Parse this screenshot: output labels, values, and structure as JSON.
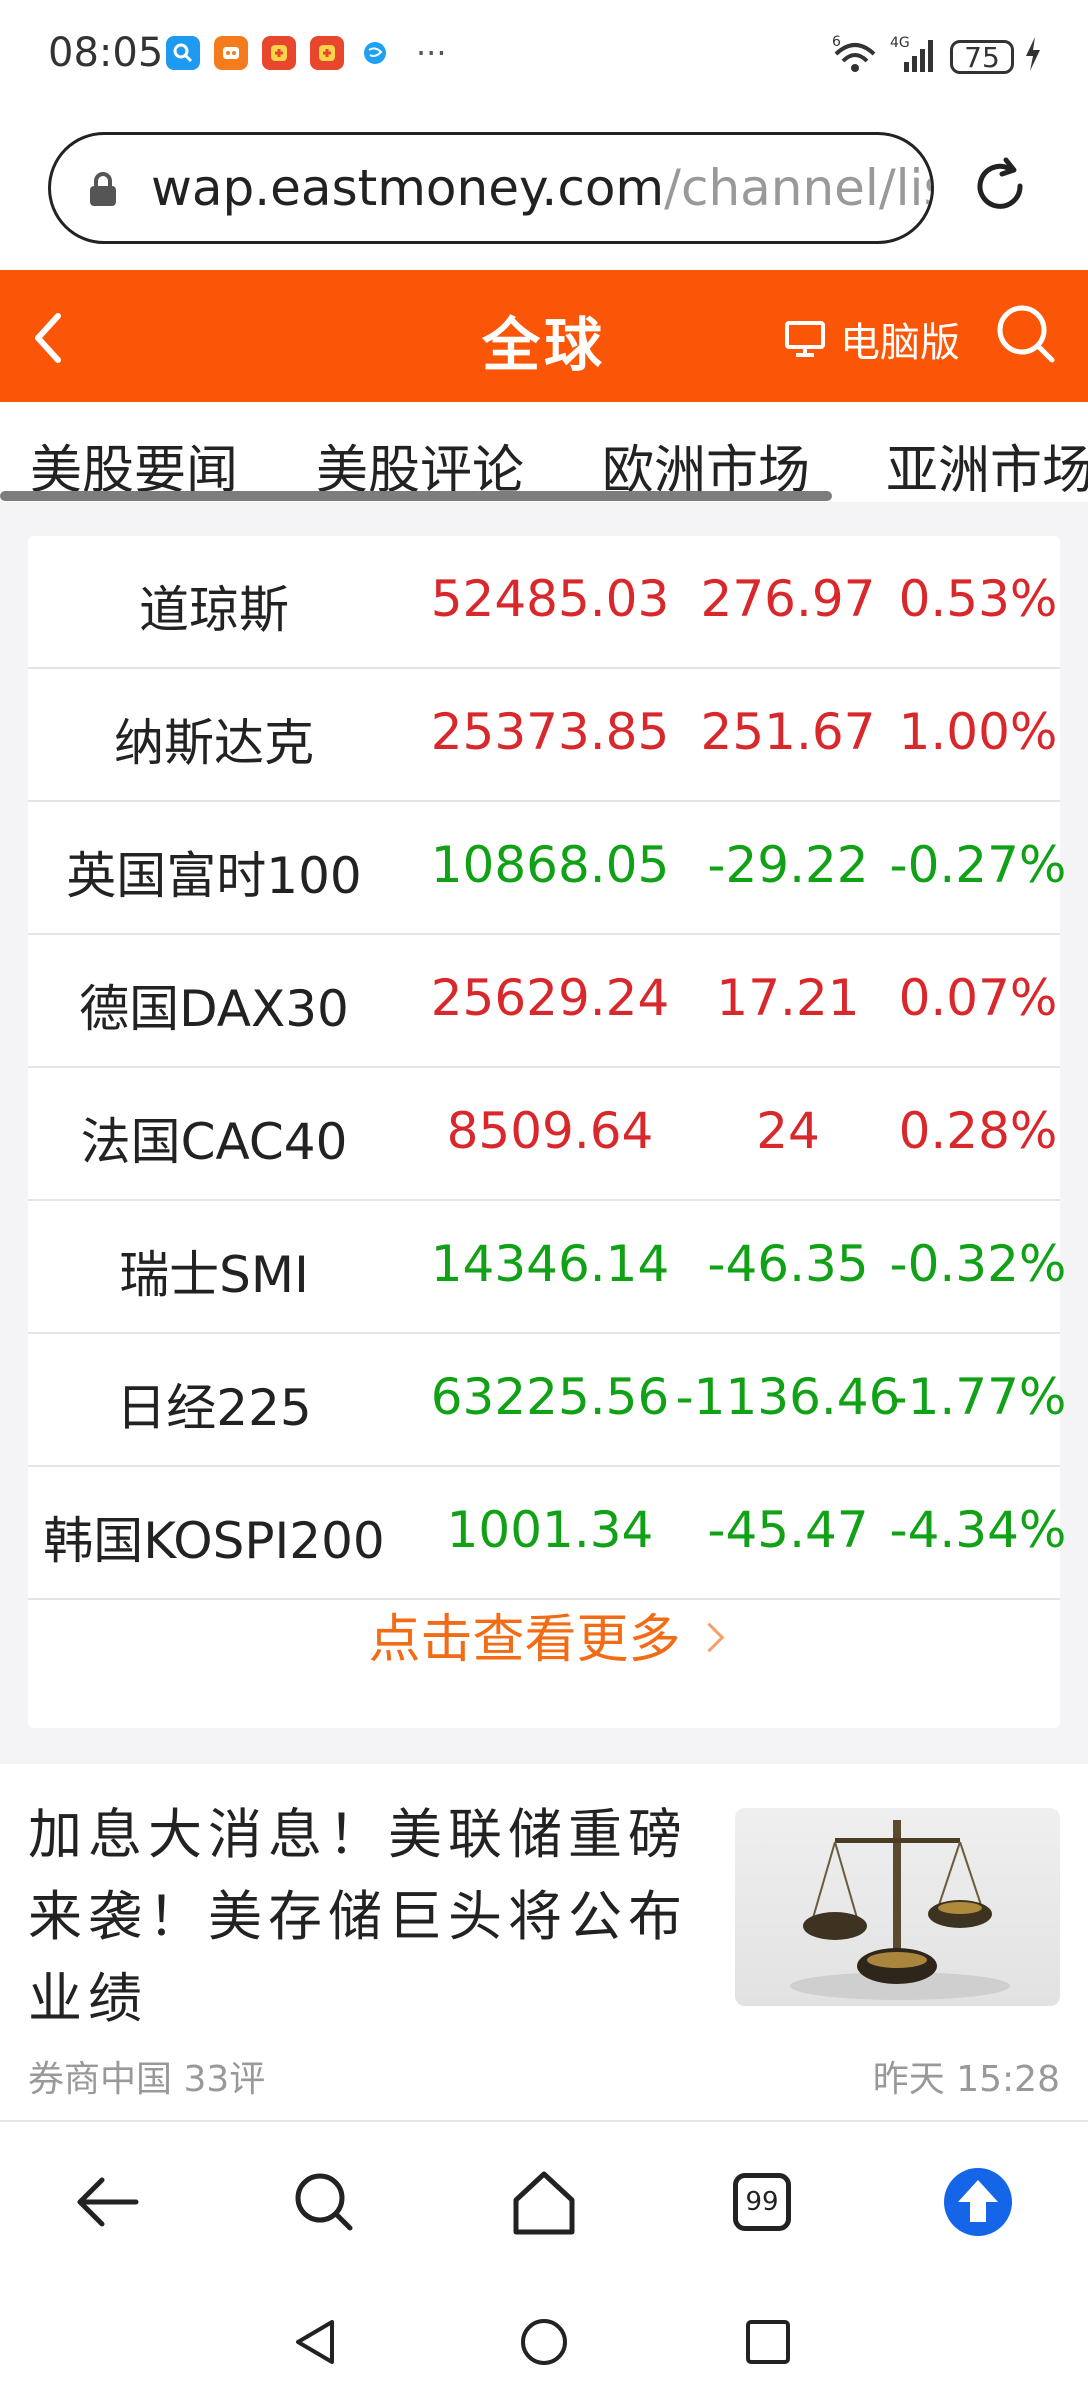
{
  "status_bar": {
    "time": "08:05",
    "more": "···",
    "network_label_1": "6",
    "network_label_2": "4G",
    "battery": "75",
    "app_icons": [
      {
        "name": "app-icon-blue-search",
        "color": "#1e9af0"
      },
      {
        "name": "app-icon-orange",
        "color": "#f47c1d"
      },
      {
        "name": "app-icon-taobao-1",
        "color": "#e8462d"
      },
      {
        "name": "app-icon-taobao-2",
        "color": "#e8462d"
      },
      {
        "name": "app-icon-globe",
        "color": "#1ea1f2"
      }
    ]
  },
  "browser": {
    "url_domain": "wap.eastmoney.com",
    "url_rest": "/channel/lis"
  },
  "header": {
    "title": "全球",
    "pc_label": "电脑版",
    "color": "#fb5607"
  },
  "tabs": [
    {
      "label": "美股要闻"
    },
    {
      "label": "美股评论"
    },
    {
      "label": "欧洲市场"
    },
    {
      "label": "亚洲市场"
    }
  ],
  "market": {
    "rows": [
      {
        "name": "道琼斯",
        "price": "52485.03",
        "change": "276.97",
        "pct": "0.53%",
        "trend": "up"
      },
      {
        "name": "纳斯达克",
        "price": "25373.85",
        "change": "251.67",
        "pct": "1.00%",
        "trend": "up"
      },
      {
        "name": "英国富时100",
        "price": "10868.05",
        "change": "-29.22",
        "pct": "-0.27%",
        "trend": "down"
      },
      {
        "name": "德国DAX30",
        "price": "25629.24",
        "change": "17.21",
        "pct": "0.07%",
        "trend": "up"
      },
      {
        "name": "法国CAC40",
        "price": "8509.64",
        "change": "24",
        "pct": "0.28%",
        "trend": "up"
      },
      {
        "name": "瑞士SMI",
        "price": "14346.14",
        "change": "-46.35",
        "pct": "-0.32%",
        "trend": "down"
      },
      {
        "name": "日经225",
        "price": "63225.56",
        "change": "-1136.46",
        "pct": "-1.77%",
        "trend": "down"
      },
      {
        "name": "韩国KOSPI200",
        "price": "1001.34",
        "change": "-45.47",
        "pct": "-4.34%",
        "trend": "down"
      }
    ],
    "more_label": "点击查看更多",
    "up_color": "#d9282c",
    "down_color": "#11a116"
  },
  "news": {
    "title": "加息大消息！美联储重磅来袭！美存储巨头将公布业绩",
    "source": "券商中国 33评",
    "time": "昨天 15:28",
    "thumb_icon": "balance-scale-icon"
  },
  "toolbar": {
    "tabs_count": "99"
  }
}
